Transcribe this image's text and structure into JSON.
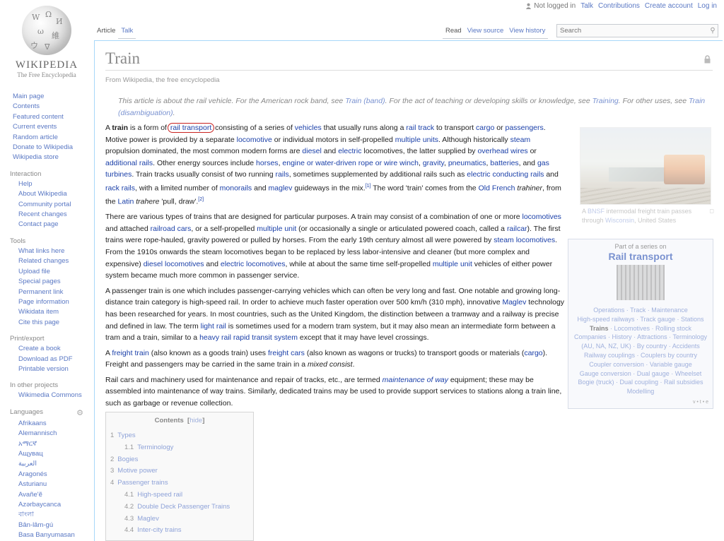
{
  "personal": {
    "status": "Not logged in",
    "links": [
      "Talk",
      "Contributions",
      "Create account",
      "Log in"
    ]
  },
  "logo": {
    "wordmark": "Wikipedia",
    "tagline": "The Free Encyclopedia"
  },
  "tabs": {
    "left": [
      "Article",
      "Talk"
    ],
    "right": [
      "Read",
      "View source",
      "View history"
    ]
  },
  "search": {
    "placeholder": "Search"
  },
  "sidebar": {
    "nav": [
      "Main page",
      "Contents",
      "Featured content",
      "Current events",
      "Random article",
      "Donate to Wikipedia",
      "Wikipedia store"
    ],
    "interaction_title": "Interaction",
    "interaction": [
      "Help",
      "About Wikipedia",
      "Community portal",
      "Recent changes",
      "Contact page"
    ],
    "tools_title": "Tools",
    "tools": [
      "What links here",
      "Related changes",
      "Upload file",
      "Special pages",
      "Permanent link",
      "Page information",
      "Wikidata item",
      "Cite this page"
    ],
    "print_title": "Print/export",
    "print": [
      "Create a book",
      "Download as PDF",
      "Printable version"
    ],
    "other_title": "In other projects",
    "other": [
      "Wikimedia Commons"
    ],
    "languages_title": "Languages",
    "languages": [
      "Afrikaans",
      "Alemannisch",
      "አማርኛ",
      "Ащувац",
      "العربية",
      "Aragonés",
      "Asturianu",
      "Avañe'ẽ",
      "Azərbaycanca",
      "বাংলা",
      "Bân-lâm-gú",
      "Basa Banyumasan"
    ]
  },
  "page": {
    "title": "Train",
    "from": "From Wikipedia, the free encyclopedia"
  },
  "hatnote": {
    "t1": "This article is about the rail vehicle. For the American rock band, see ",
    "l1": "Train (band)",
    "t2": ". For the act of teaching or developing skills or knowledge, see ",
    "l2": "Training",
    "t3": ". For other uses, see ",
    "l3": "Train (disambiguation)",
    "t4": "."
  },
  "p1": {
    "s1": "A ",
    "bold": "train",
    "s2": " is a form of ",
    "l1": "rail transport",
    "s3": " consisting of a series of ",
    "l2": "vehicles",
    "s4": " that usually runs along a ",
    "l3": "rail track",
    "s5": " to transport ",
    "l4": "cargo",
    "s6": " or ",
    "l5": "passengers",
    "s7": ". Motive power is provided by a separate ",
    "l6": "locomotive",
    "s8": " or individual motors in self-propelled ",
    "l7": "multiple units",
    "s9": ". Although historically ",
    "l8": "steam",
    "s10": " propulsion dominated, the most common modern forms are ",
    "l9": "diesel",
    "s11": " and ",
    "l10": "electric",
    "s12": " locomotives, the latter supplied by ",
    "l11": "overhead wires",
    "s13": " or ",
    "l12": "additional rails",
    "s14": ". Other energy sources include ",
    "l13": "horses",
    "s15": ", ",
    "l14": "engine or water-driven rope or wire winch",
    "s16": ", ",
    "l15": "gravity",
    "s17": ", ",
    "l16": "pneumatics",
    "s18": ", ",
    "l17": "batteries",
    "s19": ", and ",
    "l18": "gas turbines",
    "s20": ". Train tracks usually consist of two running ",
    "l19": "rails",
    "s21": ", sometimes supplemented by additional rails such as ",
    "l20": "electric conducting rails",
    "s22": " and ",
    "l21": "rack rails",
    "s23": ", with a limited number of ",
    "l22": "monorails",
    "s24": " and ",
    "l23": "maglev",
    "s25": " guideways in the mix.",
    "sup1": "[1]",
    "s26": " The word 'train' comes from the ",
    "l24": "Old French",
    "s27": " ",
    "i1": "trahiner",
    "s28": ", from the ",
    "l25": "Latin",
    "s29": " ",
    "i2": "trahere",
    "s30": " 'pull, draw'.",
    "sup2": "[2]"
  },
  "p2": {
    "s1": "There are various types of trains that are designed for particular purposes. A train may consist of a combination of one or more ",
    "l1": "locomotives",
    "s2": " and attached ",
    "l2": "railroad cars",
    "s3": ", or a self-propelled ",
    "l3": "multiple unit",
    "s4": " (or occasionally a single or articulated powered coach, called a ",
    "l4": "railcar",
    "s5": "). The first trains were rope-hauled, gravity powered or pulled by horses. From the early 19th century almost all were powered by ",
    "l5": "steam locomotives",
    "s6": ". From the 1910s onwards the steam locomotives began to be replaced by less labor-intensive and cleaner (but more complex and expensive) ",
    "l6": "diesel locomotives",
    "s7": " and ",
    "l7": "electric locomotives",
    "s8": ", while at about the same time self-propelled ",
    "l8": "multiple unit",
    "s9": " vehicles of either power system became much more common in passenger service."
  },
  "p3": {
    "s1": "A passenger train is one which includes passenger-carrying vehicles which can often be very long and fast. One notable and growing long-distance train category is high-speed rail. In order to achieve much faster operation over 500 km/h (310 mph), innovative ",
    "l1": "Maglev",
    "s2": " technology has been researched for years. In most countries, such as the United Kingdom, the distinction between a tramway and a railway is precise and defined in law. The term ",
    "l2": "light rail",
    "s3": " is sometimes used for a modern tram system, but it may also mean an intermediate form between a tram and a train, similar to a ",
    "l3": "heavy rail rapid transit system",
    "s4": " except that it may have level crossings."
  },
  "p4": {
    "s1": "A ",
    "l1": "freight train",
    "s2": " (also known as a goods train) uses ",
    "l2": "freight cars",
    "s3": " (also known as wagons or trucks) to transport goods or materials (",
    "l3": "cargo",
    "s4": "). Freight and passengers may be carried in the same train in a ",
    "i1": "mixed consist",
    "s5": "."
  },
  "p5": {
    "s1": "Rail cars and machinery used for maintenance and repair of tracks, etc., are termed ",
    "l1": "maintenance of way",
    "s2": " equipment; these may be assembled into maintenance of way trains. Similarly, dedicated trains may be used to provide support services to stations along a train line, such as garbage or revenue collection."
  },
  "thumb": {
    "cap1": "A ",
    "l1": "BNSF",
    "cap2": " intermodal freight train passes through ",
    "l2": "Wisconsin",
    "cap3": ", United States"
  },
  "navbox": {
    "part": "Part of a series on",
    "title": "Rail transport",
    "l1": "Operations",
    "l2": "Track",
    "l3": "Maintenance",
    "l4": "High-speed railways",
    "l5": "Track gauge",
    "l6": "Stations",
    "l7": "Trains",
    "l8": "Locomotives",
    "l9": "Rolling stock",
    "l10": "Companies",
    "l11": "History",
    "l12": "Attractions",
    "l13": "Terminology",
    "l14": "(AU, NA, NZ, UK)",
    "l15": "By country",
    "l16": "Accidents",
    "l17": "Railway couplings",
    "l18": "Couplers by country",
    "l19": "Coupler conversion",
    "l20": "Variable gauge",
    "l21": "Gauge conversion",
    "l22": "Dual gauge",
    "l23": "Wheelset",
    "l24": "Bogie (truck)",
    "l25": "Dual coupling",
    "l26": "Rail subsidies",
    "l27": "Modelling",
    "vte": "v • t • e"
  },
  "toc": {
    "title": "Contents",
    "hide": "hide",
    "items": [
      {
        "num": "1",
        "label": "Types"
      },
      {
        "num": "1.1",
        "label": "Terminology"
      },
      {
        "num": "2",
        "label": "Bogies"
      },
      {
        "num": "3",
        "label": "Motive power"
      },
      {
        "num": "4",
        "label": "Passenger trains"
      },
      {
        "num": "4.1",
        "label": "High-speed rail"
      },
      {
        "num": "4.2",
        "label": "Double Deck Passenger Trains"
      },
      {
        "num": "4.3",
        "label": "Maglev"
      },
      {
        "num": "4.4",
        "label": "Inter-city trains"
      }
    ]
  },
  "colors": {
    "link": "#1a3fa8",
    "annotation": "#c8211f",
    "frame": "#a7d7f9"
  }
}
